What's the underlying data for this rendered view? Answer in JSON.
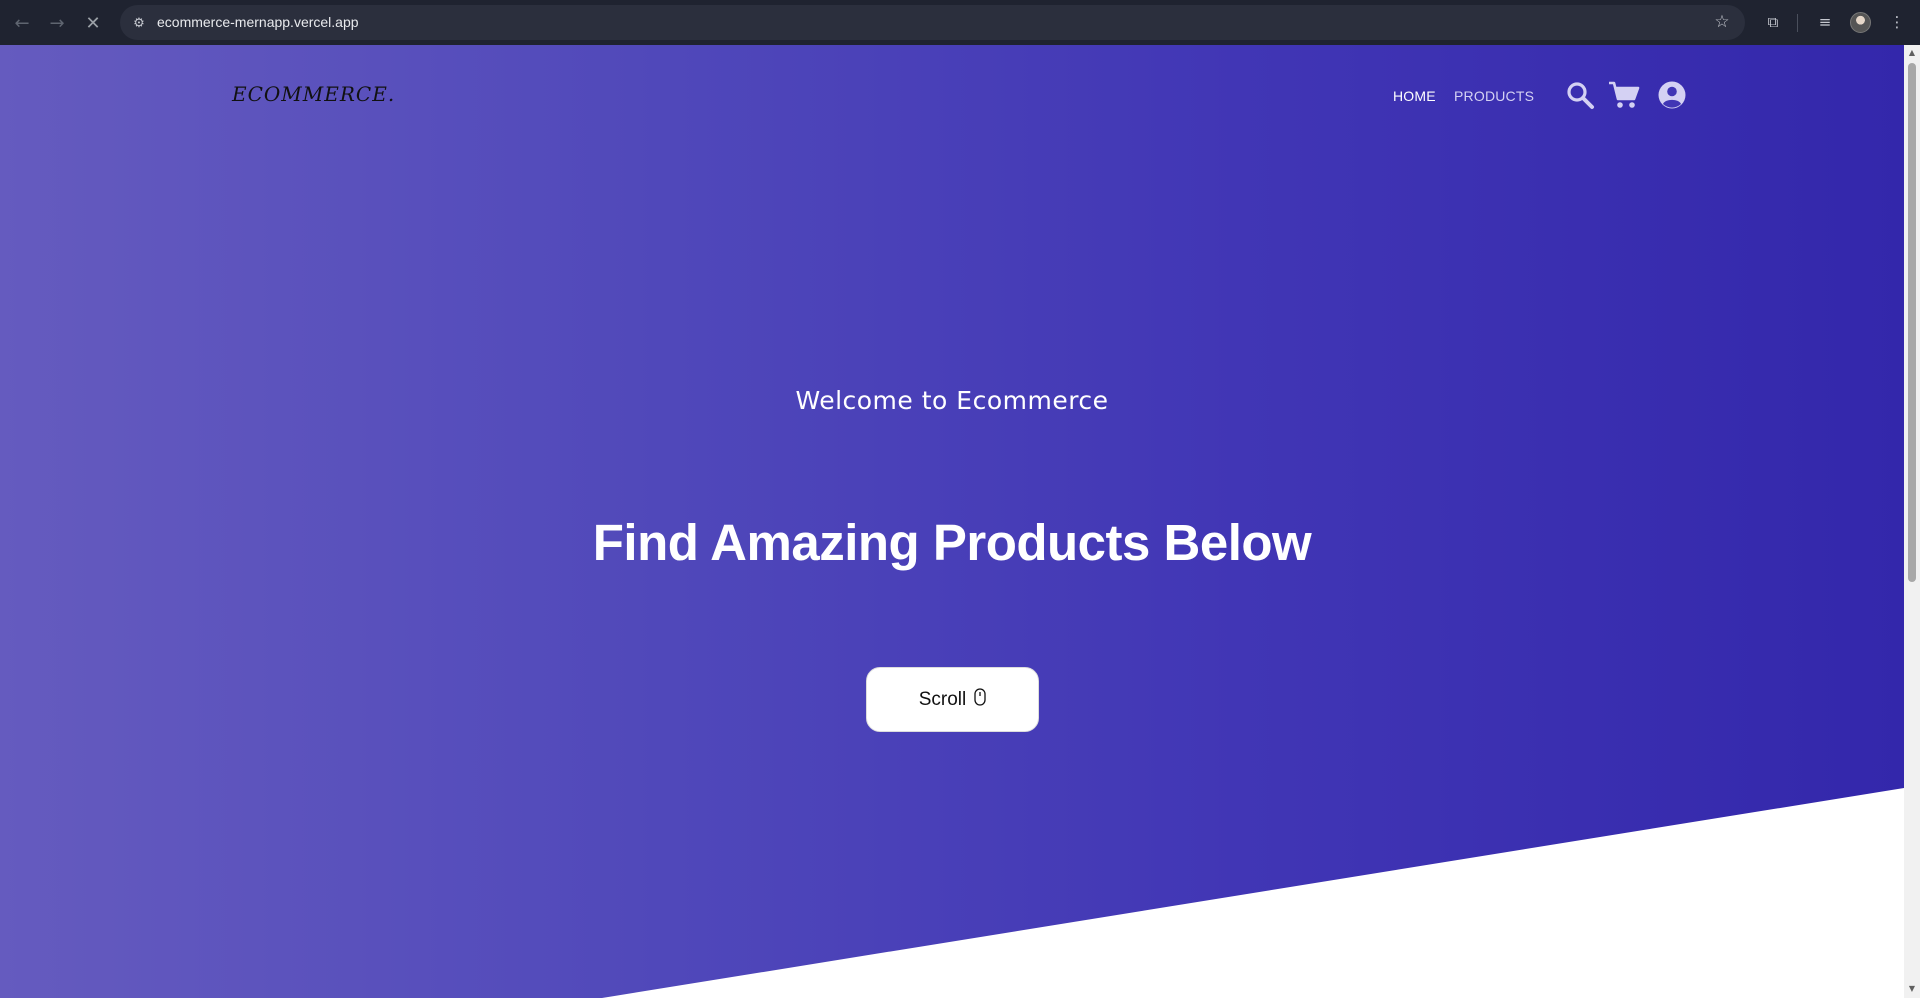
{
  "browser": {
    "url": "ecommerce-mernapp.vercel.app",
    "back_glyph": "←",
    "forward_glyph": "→",
    "stop_glyph": "✕",
    "star_glyph": "☆",
    "site_info_glyph": "⚙",
    "extensions_glyph": "⧉",
    "media_glyph": "≡",
    "menu_glyph": "⋮",
    "icons": [
      "back-icon",
      "forward-icon",
      "stop-loading-icon",
      "site-info-icon",
      "bookmark-star-icon",
      "extensions-icon",
      "media-controls-icon",
      "profile-avatar",
      "menu-icon"
    ]
  },
  "header": {
    "brand": "ECOMMERCE.",
    "nav": [
      {
        "label": "HOME",
        "active": true
      },
      {
        "label": "PRODUCTS",
        "active": false
      }
    ],
    "icons": [
      "search-icon",
      "cart-icon",
      "account-icon"
    ]
  },
  "hero": {
    "welcome": "Welcome to Ecommerce",
    "title": "Find Amazing Products Below",
    "scroll_button": "Scroll",
    "scroll_icon": "mouse-icon"
  },
  "colors": {
    "gradient_start": "#655bbf",
    "gradient_end": "#3327ab",
    "chrome_bg": "#1f2330",
    "omnibox_bg": "#2b2f3d"
  }
}
